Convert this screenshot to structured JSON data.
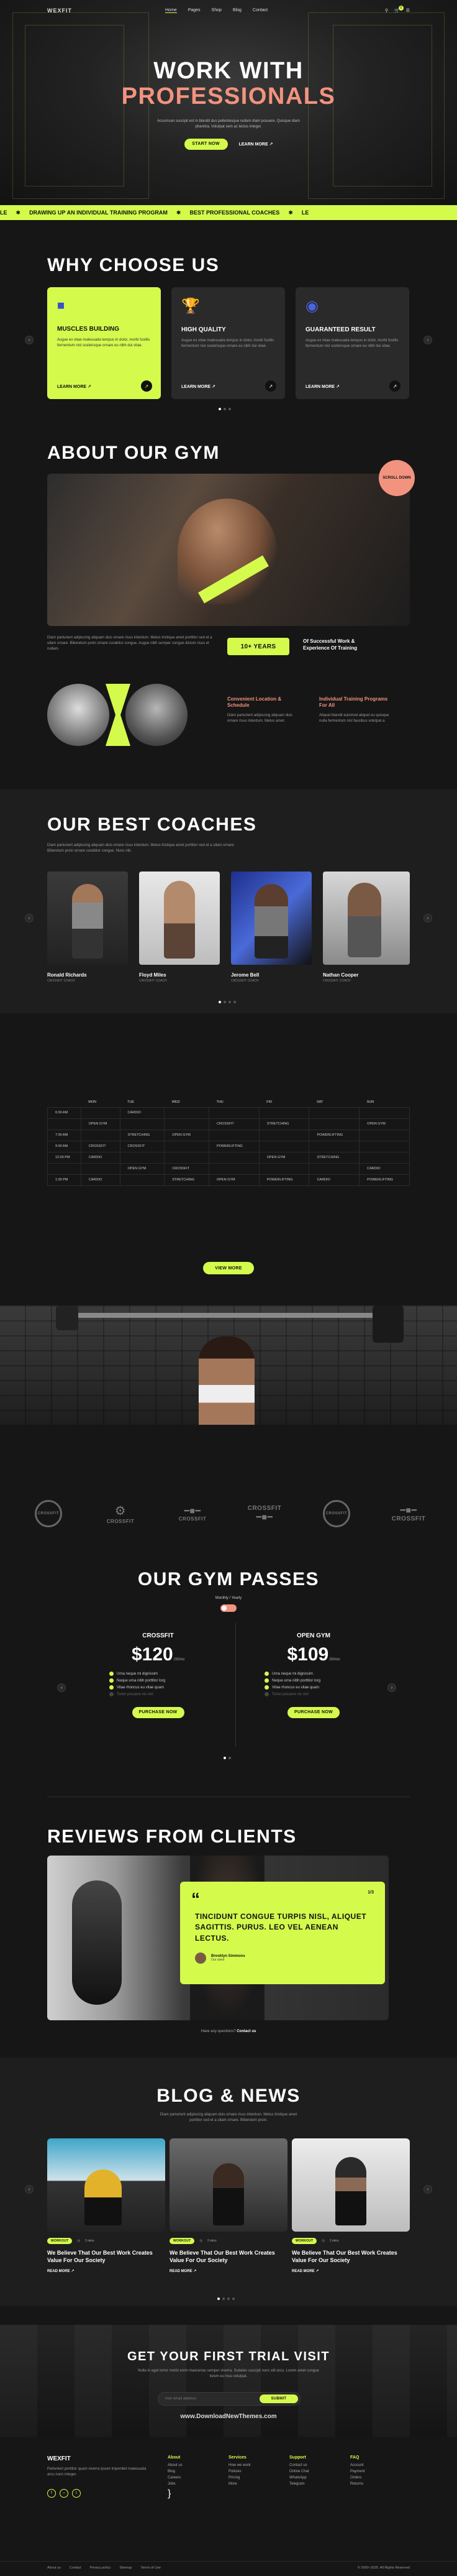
{
  "header": {
    "logo": "WEXFIT",
    "nav": [
      "Home",
      "Pages",
      "Shop",
      "Blog",
      "Contact"
    ],
    "cart_count": "0"
  },
  "hero": {
    "title_line1": "WORK WITH",
    "title_line2": "PROFESSIONALS",
    "text": "Accumsan suscipit est in blandit dus pellentesque nullam diam posuere. Quisque diam pharetra. Volutpat sem ac lectus integer.",
    "start_button": "START NOW",
    "learn_button": "LEARN MORE ↗"
  },
  "ticker": [
    "LE",
    "DRAWING UP AN INDIVIDUAL TRAINING PROGRAM",
    "BEST PROFESSIONAL COACHES",
    "LE"
  ],
  "why": {
    "title": "WHY CHOOSE US",
    "cards": [
      {
        "title": "MUSCLES BUILDING",
        "text": "Augue ex vitae malesuada tempus in dolor, morbi fusillis fermentum nisl scelerisque ornare eu nibh dui vitae.",
        "link": "LEARN MORE ↗"
      },
      {
        "title": "HIGH QUALITY",
        "text": "Augue ex vitae malesuada tempus in dolor, morbi fusillis fermentum nisl scelerisque ornare eu nibh dui vitae.",
        "link": "LEARN MORE ↗"
      },
      {
        "title": "GUARANTEED RESULT",
        "text": "Augue ex vitae malesuada tempus in dolor, morbi fusillis fermentum nisl scelerisque ornare eu nibh dui vitae.",
        "link": "LEARN MORE ↗"
      }
    ]
  },
  "about": {
    "title": "ABOUT OUR GYM",
    "badge": "SCROLL DOWN",
    "text": "Diam parturient adipiscing aliquam duis ornare risus interdum. Metus tristique amet porttitor sed et a ullam ornare. Bibendum proin ornare curabitur congue. Augue nibh semper congue dictum risus et nullam.",
    "years": "10+ YEARS",
    "years_text": "Of Successful Work & Experience Of Training",
    "feat1_title": "Convenient Location & Schedule",
    "feat1_text": "Diam parturient adipiscing aliquam duis ornare risus interdum. Metus amet.",
    "feat2_title": "Individual Training Programs For All",
    "feat2_text": "Aliquet blandit euismod aliquet eu quisque nulla fermentum nisl faucibus volutpat a."
  },
  "coaches": {
    "title": "OUR BEST COACHES",
    "text": "Diam parturient adipiscing aliquam duis ornare risus interdum. Metus tristique amet porttitor sed et a ullam ornare. Bibendum proin ornare curabitur congue. Nunc nib.",
    "list": [
      {
        "name": "Ronald Richards",
        "role": "CROSSFIT COACH"
      },
      {
        "name": "Floyd Miles",
        "role": "CROSSFIT COACH"
      },
      {
        "name": "Jerome Bell",
        "role": "CROSSFIT COACH"
      },
      {
        "name": "Nathan Cooper",
        "role": "CROSSFIT COACH"
      }
    ]
  },
  "schedule": {
    "days": [
      "",
      "MON",
      "TUE",
      "WED",
      "THU",
      "FRI",
      "SAT",
      "SUN"
    ],
    "rows": [
      [
        "6:00 AM",
        "",
        "CARDIO",
        "",
        "",
        "",
        "",
        ""
      ],
      [
        "",
        "OPEN GYM",
        "",
        "",
        "CROSSFIT",
        "STRETCHING",
        "",
        "OPEN GYM"
      ],
      [
        "7:00 AM",
        "",
        "STRETCHING",
        "OPEN GYM",
        "",
        "",
        "POWERLIFTING",
        ""
      ],
      [
        "9:00 AM",
        "CROSSFIT",
        "CROSSFIT",
        "",
        "POWERLIFTING",
        "",
        "",
        ""
      ],
      [
        "12:00 PM",
        "CARDIO",
        "",
        "",
        "",
        "OPEN GYM",
        "STRETCHING",
        ""
      ],
      [
        "",
        "",
        "OPEN GYM",
        "CROSSFIT",
        "",
        "",
        "",
        "CARDIO"
      ],
      [
        "1:00 PM",
        "CARDIO",
        "",
        "STRETCHING",
        "OPEN GYM",
        "POWERLIFTING",
        "CARDIO",
        "POWERLIFTING"
      ]
    ],
    "button": "VIEW MORE"
  },
  "brand_logos": [
    "CROSSFIT",
    "CROSSFIT",
    "CROSSFIT",
    "CROSSFIT",
    "CROSSFIT",
    "CROSSFIT"
  ],
  "passes": {
    "title": "OUR GYM PASSES",
    "toggle_left": "Monthly",
    "toggle_right": "Yearly",
    "plans": [
      {
        "name": "CROSSFIT",
        "price": "$120",
        "period": ".00/mo",
        "features": [
          "Urna neque mi dignissim",
          "Neque urna nibh porttitor lorg",
          "Vitae rhoncus eu vitae quam"
        ],
        "off": [
          "Tortor posuere nis nisl"
        ],
        "button": "PURCHASE NOW"
      },
      {
        "name": "OPEN GYM",
        "price": "$109",
        "period": ".00/mo",
        "features": [
          "Urna neque mi dignissim",
          "Neque urna nibh porttitor lorg",
          "Vitae rhoncus eu vitae quam"
        ],
        "off": [
          "Tortor posuere nis nisl"
        ],
        "button": "PURCHASE NOW"
      }
    ]
  },
  "reviews": {
    "title": "REVIEWS FROM CLIENTS",
    "counter": "1/3",
    "quote": "TINCIDUNT CONGUE TURPIS NISL, ALIQUET SAGITTIS. PURUS. LEO VEL AENEAN LECTUS.",
    "author": "Brooklyn Simmons",
    "author_role": "Our client",
    "footer_text": "Have any questions?",
    "footer_link": "Contact us"
  },
  "blog": {
    "title": "BLOG & NEWS",
    "text": "Diam parturient adipiscing aliquam duis ornare risus interdum. Metus tristique amet porttitor sed et a ullam ornare. Bibendum proin.",
    "posts": [
      {
        "tag": "WORKOUT",
        "date": "2 mins",
        "title": "We Believe That Our Best Work Creates Value For Our Society",
        "link": "READ MORE ↗"
      },
      {
        "tag": "WORKOUT",
        "date": "2 mins",
        "title": "We Believe That Our Best Work Creates Value For Our Society",
        "link": "READ MORE ↗"
      },
      {
        "tag": "WORKOUT",
        "date": "2 mins",
        "title": "We Believe That Our Best Work Creates Value For Our Society",
        "link": "READ MORE ↗"
      }
    ]
  },
  "trial": {
    "title": "GET YOUR FIRST TRIAL VISIT",
    "text": "Nulla in eget tortor morbi enim maecenas semper viverra. Sodales suscipit nunc elit arcu. Lorem amet congue lorem eu mus volutpat.",
    "placeholder": "Your email address",
    "button": "SUBMIT",
    "watermark": "www.DownloadNewThemes.com"
  },
  "footer": {
    "logo": "WEXFIT",
    "text": "Parturient porttitor quam viverra ipsum imperdiet malesuada arcu nunc integer.",
    "cols": [
      {
        "title": "About",
        "items": [
          "About us",
          "Blog",
          "Careers",
          "Jobs"
        ]
      },
      {
        "title": "Services",
        "items": [
          "How we work",
          "Policies",
          "Pricing",
          "More"
        ]
      },
      {
        "title": "Support",
        "items": [
          "Contact us",
          "Online Chat",
          "WhatsApp",
          "Telegram"
        ]
      },
      {
        "title": "FAQ",
        "items": [
          "Account",
          "Payment",
          "Orders",
          "Returns"
        ]
      }
    ],
    "bottom_links": [
      "About us",
      "Contact",
      "Privacy policy",
      "Sitemap",
      "Terms of Use"
    ],
    "copyright": "© 2000–2025. All Rights Reserved"
  },
  "colors": {
    "accent": "#d4fa4c",
    "salmon": "#f2937f",
    "bg": "#161616"
  }
}
